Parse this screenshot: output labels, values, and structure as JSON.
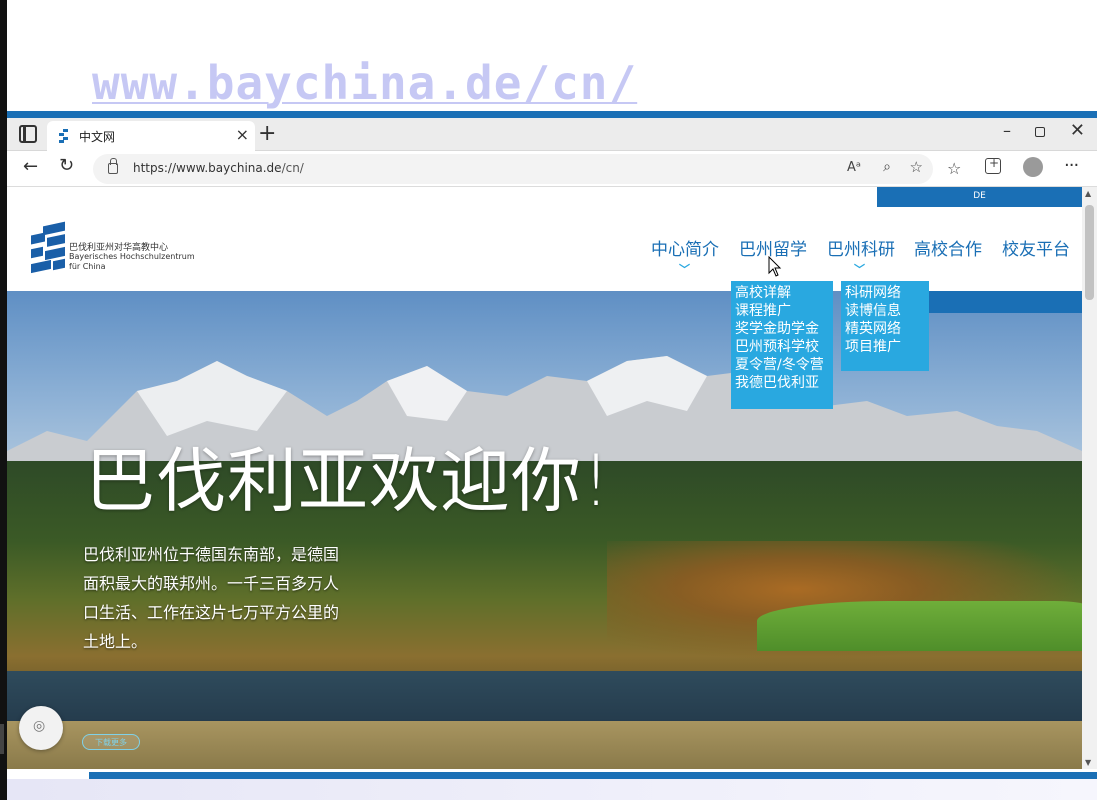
{
  "overlay": {
    "url_text": "www.baychina.de/cn/"
  },
  "browser": {
    "tab_title": "中文网",
    "tab_close": "×",
    "new_tab": "+",
    "window_min": "–",
    "window_close": "✕",
    "url_host": "https://www.baychina.de",
    "url_path": "/cn/",
    "read_aloud": "Aᵃ",
    "more_menu": "···"
  },
  "site": {
    "lang": "DE",
    "logo": {
      "cn": "巴伐利亚州对华高教中心",
      "de_line1": "Bayerisches Hochschulzentrum",
      "de_line2": "für China"
    },
    "nav": [
      {
        "label": "中心简介"
      },
      {
        "label": "巴州留学"
      },
      {
        "label": "巴州科研"
      },
      {
        "label": "高校合作"
      },
      {
        "label": "校友平台"
      }
    ],
    "dropdown_study": [
      "高校详解",
      "课程推广",
      "奖学金助学金",
      "巴州预科学校",
      "夏令营/冬令营",
      "我德巴伐利亚"
    ],
    "dropdown_research": [
      "科研网络",
      "读博信息",
      "精英网络",
      "项目推广"
    ],
    "hero": {
      "title": "巴伐利亚欢迎你!",
      "text": "巴伐利亚州位于德国东南部，是德国面积最大的联邦州。一千三百多万人口生活、工作在这片七万平方公里的土地上。"
    },
    "pill_label": "下载更多"
  },
  "colors": {
    "brand_blue": "#1a6fb5",
    "dropdown_blue": "#29a8e0",
    "overlay_text": "#c6c8f4"
  }
}
